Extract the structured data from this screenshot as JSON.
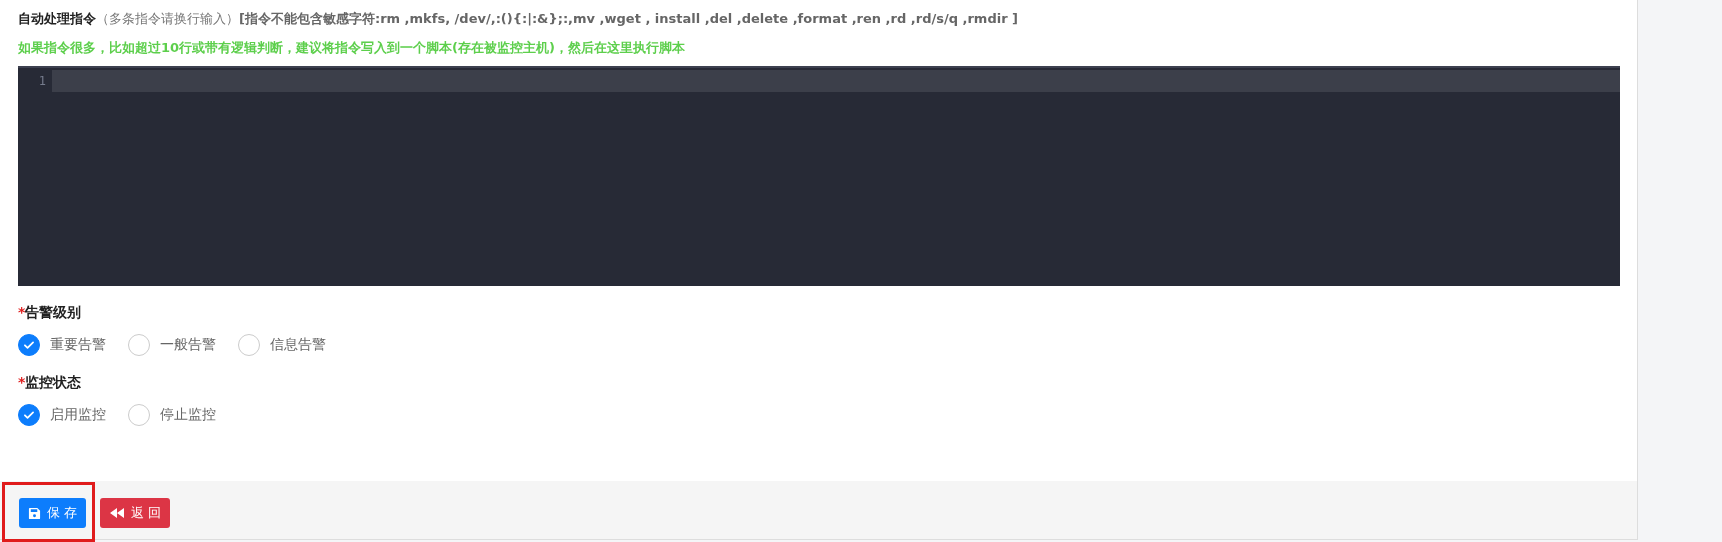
{
  "command_field": {
    "label": "自动处理指令",
    "hint": "（多条指令请换行输入）",
    "restriction": "[指令不能包含敏感字符:rm ,mkfs, /dev/,:(){:|:&};:,mv ,wget , install ,del ,delete ,format ,ren ,rd ,rd/s/q ,rmdir ]",
    "advice": "如果指令很多，比如超过10行或带有逻辑判断，建议将指令写入到一个脚本(存在被监控主机)，然后在这里执行脚本",
    "line_numbers": [
      "1"
    ]
  },
  "radio_groups": [
    {
      "label": "告警级别",
      "required_mark": "*",
      "options": [
        {
          "label": "重要告警",
          "selected": true
        },
        {
          "label": "一般告警",
          "selected": false
        },
        {
          "label": "信息告警",
          "selected": false
        }
      ]
    },
    {
      "label": "监控状态",
      "required_mark": "*",
      "options": [
        {
          "label": "启用监控",
          "selected": true
        },
        {
          "label": "停止监控",
          "selected": false
        }
      ]
    }
  ],
  "buttons": [
    {
      "kind": "save",
      "label": "保 存",
      "highlighted": true
    },
    {
      "kind": "back",
      "label": "返 回",
      "highlighted": false
    }
  ]
}
